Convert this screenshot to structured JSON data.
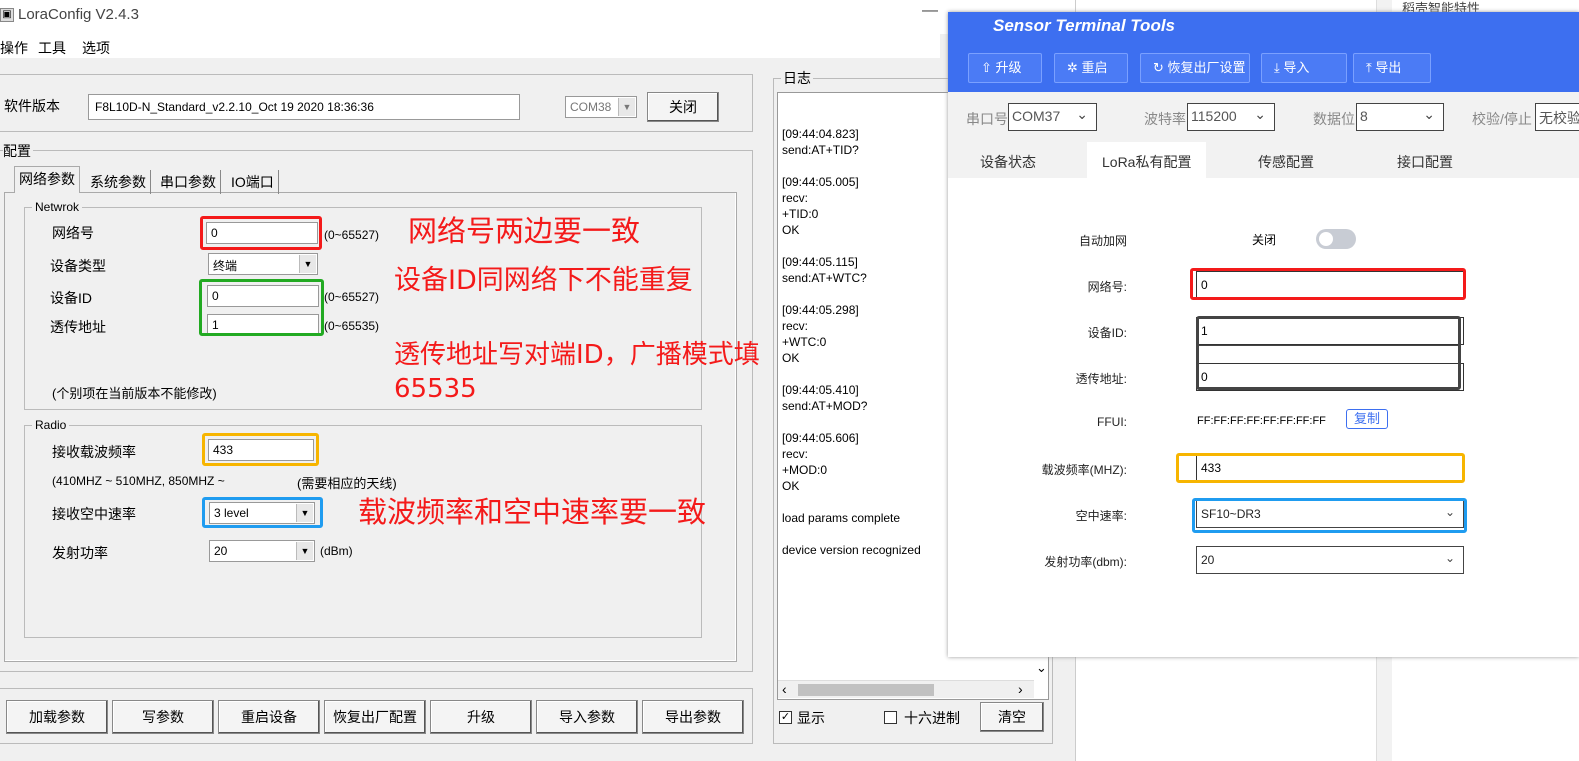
{
  "app": {
    "title": "LoraConfig V2.4.3",
    "menu": [
      "操作",
      "工具",
      "选项"
    ]
  },
  "version": {
    "label": "软件版本",
    "value": "F8L10D-N_Standard_v2.2.10_Oct 19 2020 18:36:36",
    "port": "COM38",
    "close": "关闭"
  },
  "config": {
    "label": "配置",
    "tabs": [
      "网络参数",
      "系统参数",
      "串口参数",
      "IO端口"
    ]
  },
  "network": {
    "group": "Netwrok",
    "net_id_label": "网络号",
    "net_id": "0",
    "net_range": "(0~65527)",
    "dev_type_label": "设备类型",
    "dev_type": "终端",
    "dev_id_label": "设备ID",
    "dev_id": "0",
    "dev_range": "(0~65527)",
    "trans_label": "透传地址",
    "trans": "1",
    "trans_range": "(0~65535)",
    "note": "(个别项在当前版本不能修改)"
  },
  "radio": {
    "group": "Radio",
    "freq_label": "接收载波频率",
    "freq": "433",
    "freq_range": "(410MHZ ~ 510MHZ, 850MHZ ~",
    "antenna": "(需要相应的天线)",
    "rate_label": "接收空中速率",
    "rate": "3 level",
    "power_label": "发射功率",
    "power": "20",
    "power_unit": "(dBm)"
  },
  "buttons": [
    "加载参数",
    "写参数",
    "重启设备",
    "恢复出厂配置",
    "升级",
    "导入参数",
    "导出参数"
  ],
  "log": {
    "title": "日志",
    "entries": [
      "[09:44:04.823]\nsend:AT+TID?",
      "[09:44:05.005]\nrecv:\n+TID:0\nOK",
      "[09:44:05.115]\nsend:AT+WTC?",
      "[09:44:05.298]\nrecv:\n+WTC:0\nOK",
      "[09:44:05.410]\nsend:AT+MOD?",
      "[09:44:05.606]\nrecv:\n+MOD:0\nOK",
      "load params complete",
      "device version recognized"
    ],
    "show": "显示",
    "hex": "十六进制",
    "clear": "清空"
  },
  "annotations": {
    "a1": "网络号两边要一致",
    "a2": "设备ID同网络下不能重复",
    "a3": "透传地址写对端ID，广播模式填",
    "a3b": "65535",
    "a4": "载波频率和空中速率要一致"
  },
  "bg": {
    "top_right": "稻壳智能特性"
  },
  "stt": {
    "title": "Sensor Terminal Tools",
    "buttons": [
      "升级",
      "重启",
      "恢复出厂设置",
      "导入",
      "导出"
    ],
    "port_label": "串口号",
    "port": "COM37",
    "baud_label": "波特率",
    "baud": "115200",
    "data_label": "数据位",
    "data": "8",
    "parity_label": "校验/停止",
    "parity": "无校验",
    "tabs": [
      "设备状态",
      "LoRa私有配置",
      "传感配置",
      "接口配置"
    ],
    "auto_label": "自动加网",
    "auto": "关闭",
    "net_label": "网络号:",
    "net": "0",
    "devid_label": "设备ID:",
    "devid": "1",
    "trans_label": "透传地址:",
    "trans": "0",
    "ffui_label": "FFUI:",
    "ffui": "FF:FF:FF:FF:FF:FF:FF:FF",
    "copy": "复制",
    "freq_label": "载波频率(MHZ):",
    "freq": "433",
    "rate_label": "空中速率:",
    "rate": "SF10~DR3",
    "power_label": "发射功率(dbm):",
    "power": "20"
  },
  "colors": {
    "red": "#f41a1a",
    "green": "#22aa22",
    "orange": "#f7b500",
    "blue": "#1f9cf0",
    "dark": "#444444",
    "accent": "#3d6ff0"
  }
}
